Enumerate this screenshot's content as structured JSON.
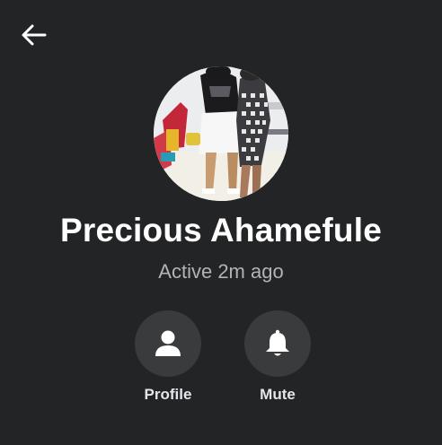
{
  "header": {
    "back_icon": "arrow-left-icon"
  },
  "contact": {
    "name": "Precious Ahamefule",
    "status": "Active 2m ago",
    "avatar_icon": "profile-photo"
  },
  "actions": [
    {
      "label": "Profile",
      "icon": "person-icon"
    },
    {
      "label": "Mute",
      "icon": "bell-icon"
    }
  ],
  "colors": {
    "background": "#232425",
    "button_circle": "#3a3b3c",
    "name_text": "#ffffff",
    "status_text": "#b0b3b8"
  }
}
